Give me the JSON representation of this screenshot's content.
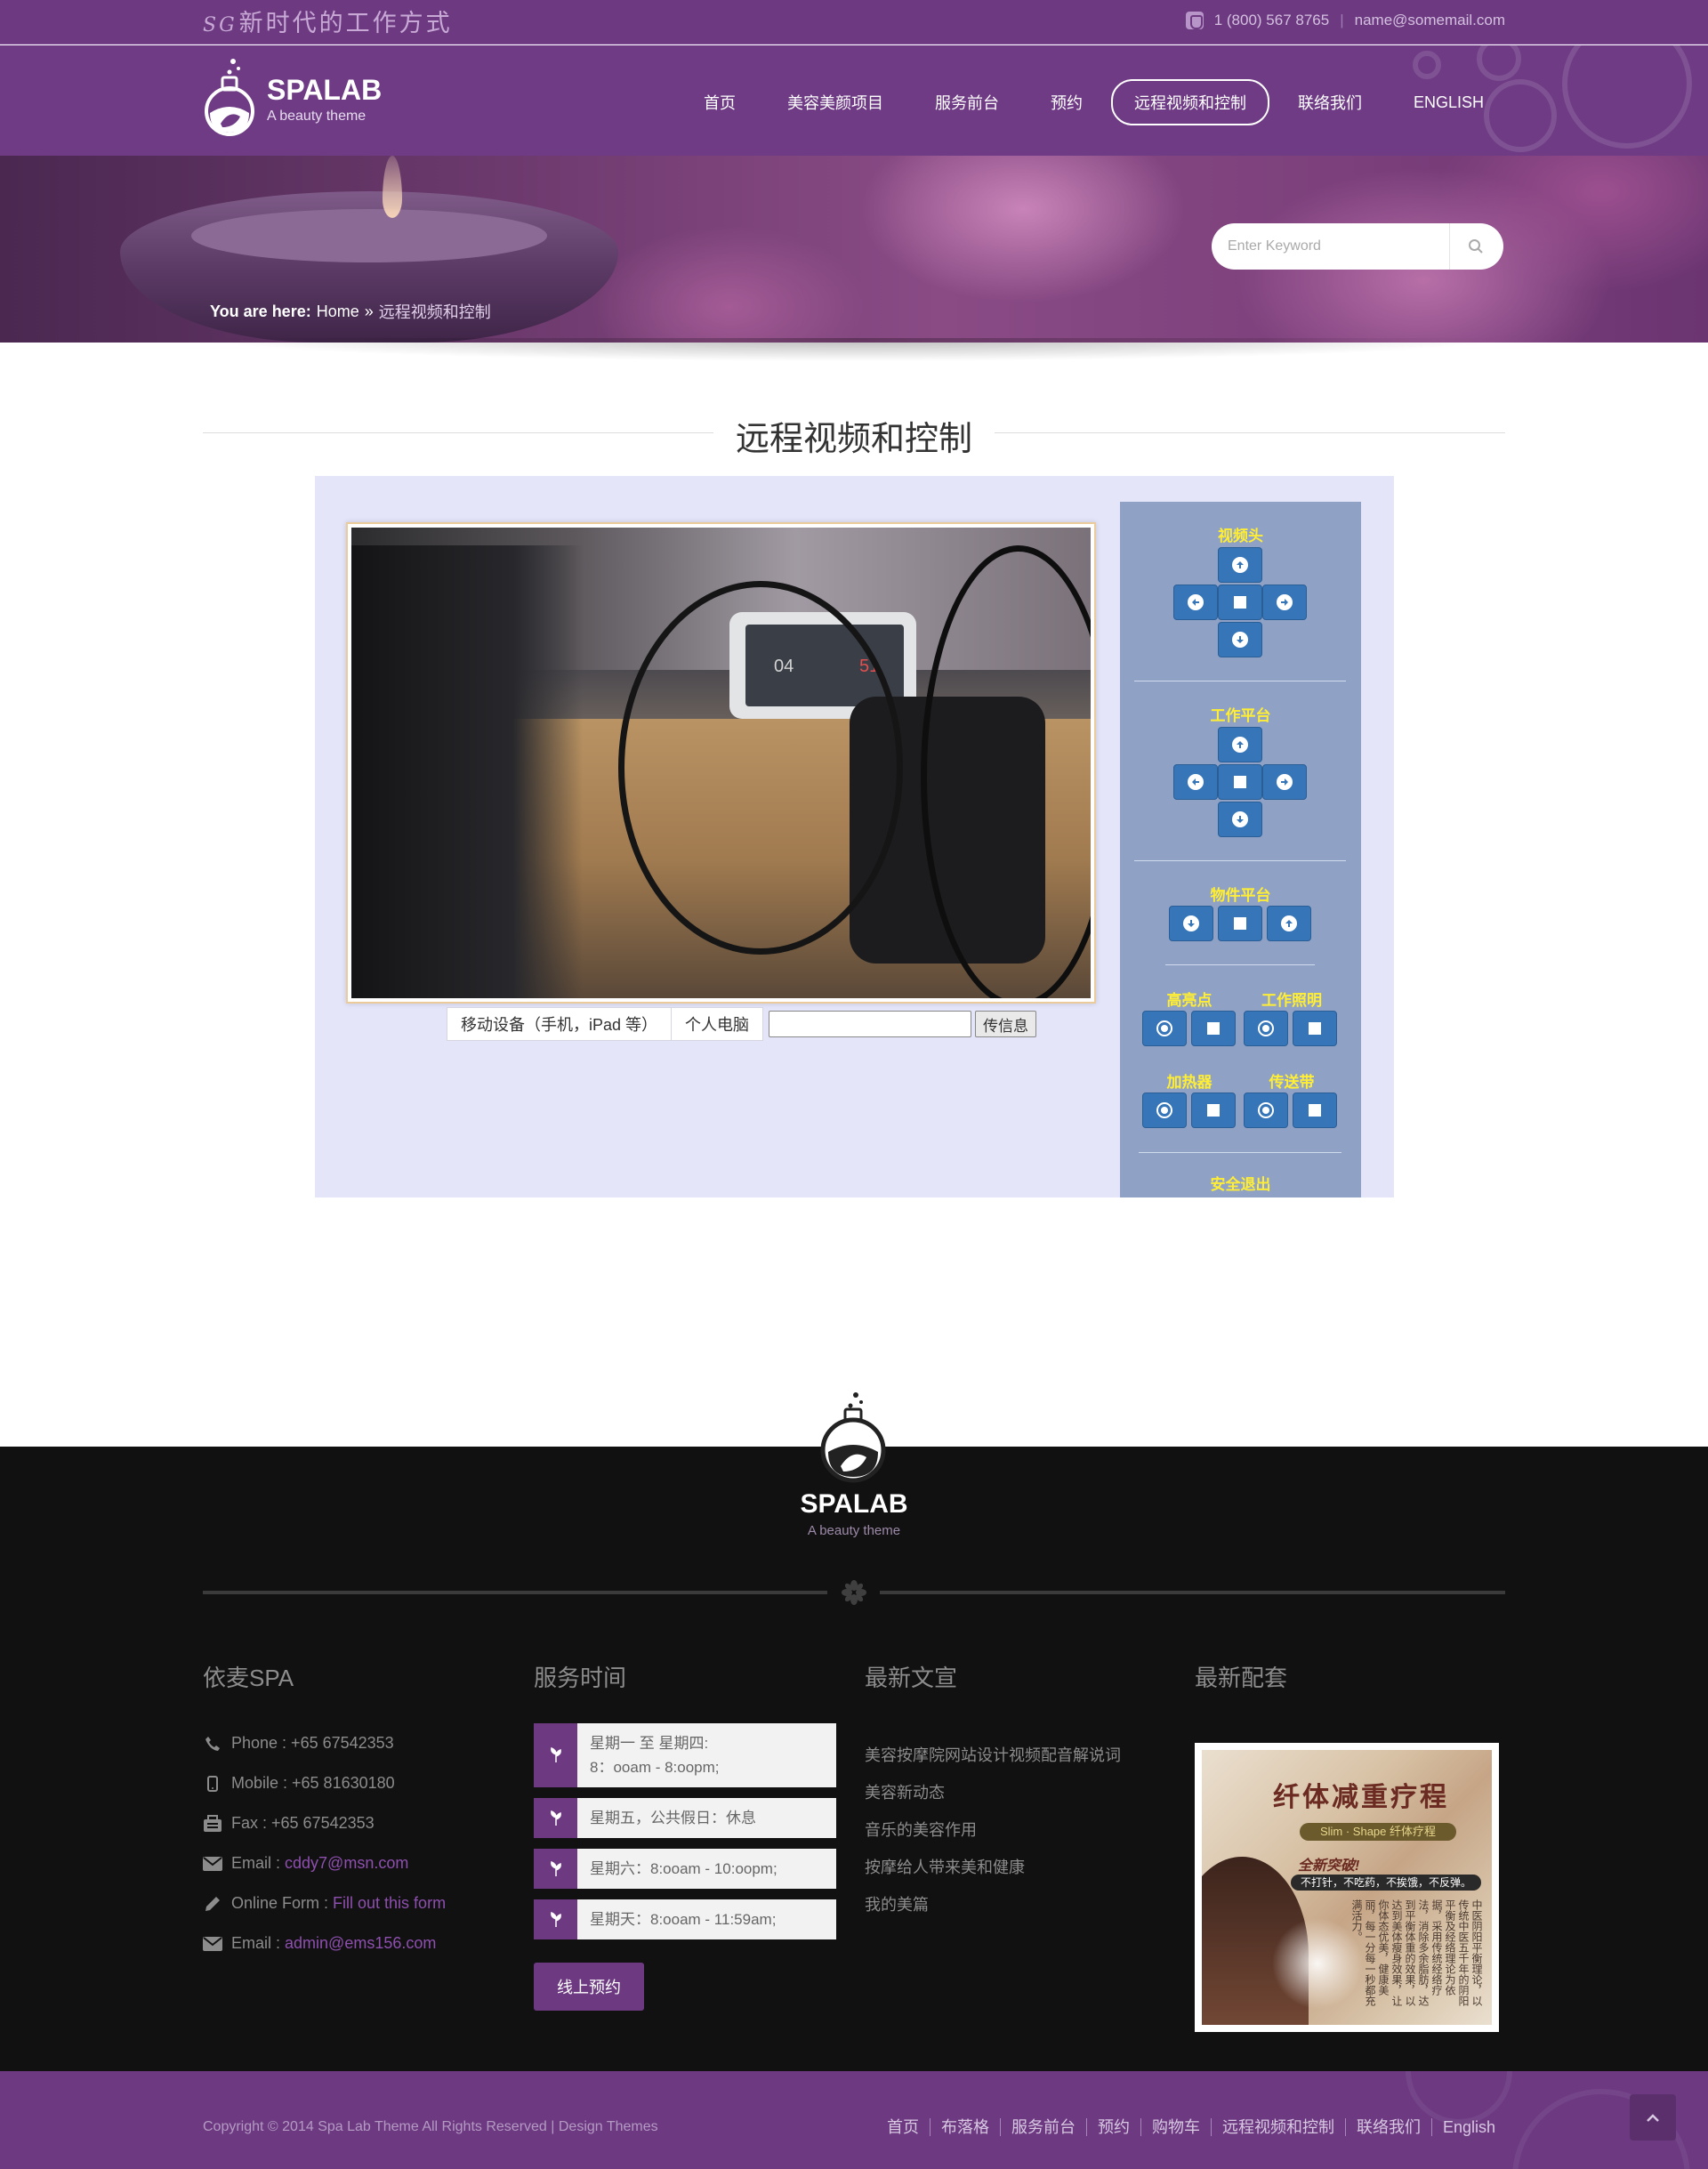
{
  "topbar": {
    "slogan_prefix": "SG",
    "slogan": "新时代的工作方式",
    "phone": "1 (800) 567 8765",
    "email": "name@somemail.com"
  },
  "brand": {
    "name": "SPALAB",
    "tagline": "A beauty theme"
  },
  "nav": {
    "items": [
      {
        "label": "首页",
        "active": false
      },
      {
        "label": "美容美颜项目",
        "active": false
      },
      {
        "label": "服务前台",
        "active": false
      },
      {
        "label": "预约",
        "active": false
      },
      {
        "label": "远程视频和控制",
        "active": true
      },
      {
        "label": "联络我们",
        "active": false
      },
      {
        "label": "ENGLISH",
        "active": false
      }
    ]
  },
  "search": {
    "placeholder": "Enter Keyword"
  },
  "breadcrumb": {
    "prefix": "You are here:",
    "home": "Home",
    "current": "远程视频和控制"
  },
  "page": {
    "title": "远程视频和控制"
  },
  "video": {
    "screen_time_left": "04",
    "screen_time_right": "51",
    "tabs": [
      "移动设备（手机，iPad 等）",
      "个人电脑"
    ],
    "message_value": "",
    "send_label": "传信息"
  },
  "controls": {
    "camera_title": "视频头",
    "workbench_title": "工作平台",
    "object_title": "物件平台",
    "highlight_title": "高亮点",
    "worklight_title": "工作照明",
    "heater_title": "加热器",
    "conveyor_title": "传送带",
    "exit_label": "安全退出"
  },
  "footer": {
    "brand_name": "SPALAB",
    "brand_tagline": "A beauty theme",
    "contact": {
      "title": "依麦SPA",
      "phone": "Phone : +65 67542353",
      "mobile": "Mobile : +65 81630180",
      "fax": "Fax : +65 67542353",
      "email_label": "Email : ",
      "email_value": "cddy7@msn.com",
      "form_label": "Online Form : ",
      "form_link": "Fill out this form",
      "email2_label": "Email : ",
      "email2_value": "admin@ems156.com"
    },
    "hours": {
      "title": "服务时间",
      "rows": [
        "星期一 至 星期四:",
        "8：ooam - 8:oopm;",
        "星期五，公共假日：休息",
        "星期六：8:ooam - 10:oopm;",
        "星期天：8:ooam - 11:59am;"
      ],
      "book_label": "线上预约"
    },
    "news": {
      "title": "最新文宣",
      "items": [
        "美容按摩院网站设计视频配音解说词",
        "美容新动态",
        "音乐的美容作用",
        "按摩给人带来美和健康",
        "我的美篇"
      ]
    },
    "packages": {
      "title": "最新配套",
      "promo_title": "纤体减重疗程",
      "promo_ribbon": "Slim · Shape 纤体疗程",
      "promo_headline": "全新突破!",
      "promo_bar": "不打针，不吃药，不挨饿，不反弹。",
      "promo_body": "中医阴阳平衡理论，以传统中医五千年的阴阳平衡及经络理论为依据，采用传统经络疗法，消除多余脂肪，达到平衡体重的效果，以达到美体瘦身效果，让你体态优美，健康美丽，每一分每一秒都充满活力。"
    }
  },
  "bottombar": {
    "copyright": "Copyright © 2014 Spa Lab Theme All Rights Reserved | Design Themes",
    "links": [
      "首页",
      "布落格",
      "服务前台",
      "预约",
      "购物车",
      "远程视频和控制",
      "联络我们",
      "English"
    ]
  },
  "colors": {
    "brand_purple": "#6d3a82",
    "panel_bg": "#e5e5fa",
    "control_bg": "#8fa2c6",
    "button_blue": "#3575b8",
    "title_yellow": "#ffee33"
  }
}
